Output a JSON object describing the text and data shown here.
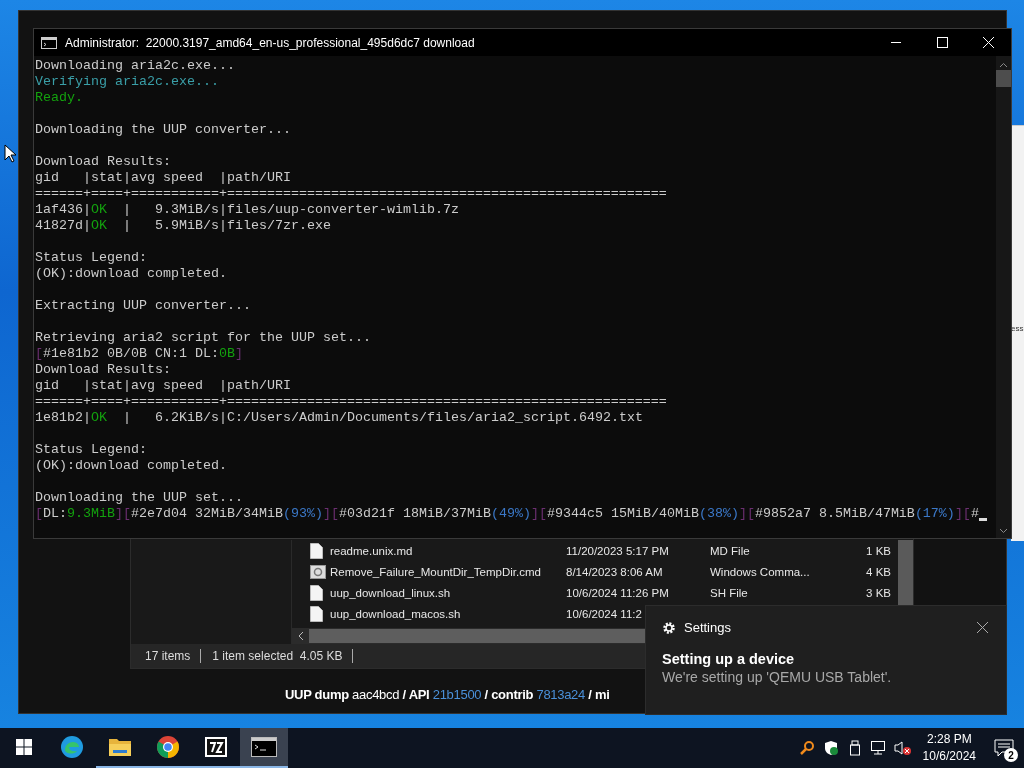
{
  "console": {
    "title": "Administrator:  22000.3197_amd64_en-us_professional_495d6dc7 download",
    "cursor_visible": true,
    "lines": [
      {
        "kind": "text",
        "segments": [
          {
            "text": "Downloading aria2c.exe..."
          }
        ]
      },
      {
        "kind": "text",
        "segments": [
          {
            "text": "Verifying aria2c.exe...",
            "color": "#3a9fa8"
          }
        ]
      },
      {
        "kind": "text",
        "segments": [
          {
            "text": "Ready.",
            "color": "#13a10e"
          }
        ]
      },
      {
        "kind": "blank"
      },
      {
        "kind": "text",
        "segments": [
          {
            "text": "Downloading the UUP converter..."
          }
        ]
      },
      {
        "kind": "blank"
      },
      {
        "kind": "text",
        "segments": [
          {
            "text": "Download Results:"
          }
        ]
      },
      {
        "kind": "text",
        "segments": [
          {
            "text": "gid   |stat|avg speed  |path/URI"
          }
        ]
      },
      {
        "kind": "text",
        "segments": [
          {
            "text": "======+====+===========+======================================================="
          }
        ]
      },
      {
        "kind": "text",
        "segments": [
          {
            "text": "1af436|"
          },
          {
            "text": "OK",
            "color": "#13a10e"
          },
          {
            "text": "  |   9.3MiB/s|files/uup-converter-wimlib.7z"
          }
        ]
      },
      {
        "kind": "text",
        "segments": [
          {
            "text": "41827d|"
          },
          {
            "text": "OK",
            "color": "#13a10e"
          },
          {
            "text": "  |   5.9MiB/s|files/7zr.exe"
          }
        ]
      },
      {
        "kind": "blank"
      },
      {
        "kind": "text",
        "segments": [
          {
            "text": "Status Legend:"
          }
        ]
      },
      {
        "kind": "text",
        "segments": [
          {
            "text": "(OK):download completed."
          }
        ]
      },
      {
        "kind": "blank"
      },
      {
        "kind": "text",
        "segments": [
          {
            "text": "Extracting UUP converter..."
          }
        ]
      },
      {
        "kind": "blank"
      },
      {
        "kind": "text",
        "segments": [
          {
            "text": "Retrieving aria2 script for the UUP set..."
          }
        ]
      },
      {
        "kind": "text",
        "segments": [
          {
            "text": "[",
            "color": "#6b2f70"
          },
          {
            "text": "#1e81b2 0B/0B CN:1 DL:"
          },
          {
            "text": "0B",
            "color": "#13a10e"
          },
          {
            "text": "]",
            "color": "#6b2f70"
          }
        ]
      },
      {
        "kind": "text",
        "segments": [
          {
            "text": "Download Results:"
          }
        ]
      },
      {
        "kind": "text",
        "segments": [
          {
            "text": "gid   |stat|avg speed  |path/URI"
          }
        ]
      },
      {
        "kind": "text",
        "segments": [
          {
            "text": "======+====+===========+======================================================="
          }
        ]
      },
      {
        "kind": "text",
        "segments": [
          {
            "text": "1e81b2|"
          },
          {
            "text": "OK",
            "color": "#13a10e"
          },
          {
            "text": "  |   6.2KiB/s|C:/Users/Admin/Documents/files/aria2_script.6492.txt"
          }
        ]
      },
      {
        "kind": "blank"
      },
      {
        "kind": "text",
        "segments": [
          {
            "text": "Status Legend:"
          }
        ]
      },
      {
        "kind": "text",
        "segments": [
          {
            "text": "(OK):download completed."
          }
        ]
      },
      {
        "kind": "blank"
      },
      {
        "kind": "text",
        "segments": [
          {
            "text": "Downloading the UUP set..."
          }
        ]
      },
      {
        "kind": "text",
        "segments": [
          {
            "text": "[",
            "color": "#6b2f70"
          },
          {
            "text": "DL:"
          },
          {
            "text": "9.3MiB",
            "color": "#13a10e"
          },
          {
            "text": "][",
            "color": "#6b2f70"
          },
          {
            "text": "#2e7d04 32MiB/34MiB"
          },
          {
            "text": "(93%)",
            "color": "#3b78c8"
          },
          {
            "text": "][",
            "color": "#6b2f70"
          },
          {
            "text": "#03d21f 18MiB/37MiB"
          },
          {
            "text": "(49%)",
            "color": "#3b78c8"
          },
          {
            "text": "][",
            "color": "#6b2f70"
          },
          {
            "text": "#9344c5 15MiB/40MiB"
          },
          {
            "text": "(38%)",
            "color": "#3b78c8"
          },
          {
            "text": "][",
            "color": "#6b2f70"
          },
          {
            "text": "#9852a7 8.5MiB/47MiB"
          },
          {
            "text": "(17%)",
            "color": "#3b78c8"
          },
          {
            "text": "][",
            "color": "#6b2f70"
          },
          {
            "text": "#"
          }
        ]
      }
    ]
  },
  "explorer": {
    "files": [
      {
        "kind": "file",
        "name": "readme.unix.md",
        "date": "11/20/2023 5:17 PM",
        "type": "MD File",
        "size": "1 KB"
      },
      {
        "kind": "script",
        "name": "Remove_Failure_MountDir_TempDir.cmd",
        "date": "8/14/2023 8:06 AM",
        "type": "Windows Comma...",
        "size": "4 KB"
      },
      {
        "kind": "file",
        "name": "uup_download_linux.sh",
        "date": "10/6/2024 11:26 PM",
        "type": "SH File",
        "size": "3 KB"
      },
      {
        "kind": "file",
        "name": "uup_download_macos.sh",
        "date": "10/6/2024 11:2"
      }
    ],
    "status": [
      "17 items",
      "1 item selected  4.05 KB"
    ]
  },
  "browser": {
    "footer": [
      {
        "kind": "strong",
        "text": "UUP dump"
      },
      {
        "kind": "plain",
        "text": " aac4bcd "
      },
      {
        "kind": "strong",
        "text": "/ API "
      },
      {
        "kind": "link",
        "text": "21b1500"
      },
      {
        "kind": "strong",
        "text": " / contrib "
      },
      {
        "kind": "link",
        "text": "7813a24"
      },
      {
        "kind": "strong",
        "text": " / mi"
      }
    ]
  },
  "side_page": {
    "text": "ess"
  },
  "toast": {
    "app": "Settings",
    "title": "Setting up a device",
    "body": "We're setting up 'QEMU USB Tablet'."
  },
  "taskbar": {
    "apps": [
      {
        "kind": "edge",
        "open": false,
        "selected": false
      },
      {
        "kind": "folder",
        "open": true,
        "selected": false
      },
      {
        "kind": "chrome",
        "open": true,
        "selected": false
      },
      {
        "kind": "zip",
        "open": true,
        "selected": false
      },
      {
        "kind": "console",
        "open": true,
        "selected": true
      }
    ],
    "time": "2:28 PM",
    "date": "10/6/2024",
    "notifications": "2"
  }
}
